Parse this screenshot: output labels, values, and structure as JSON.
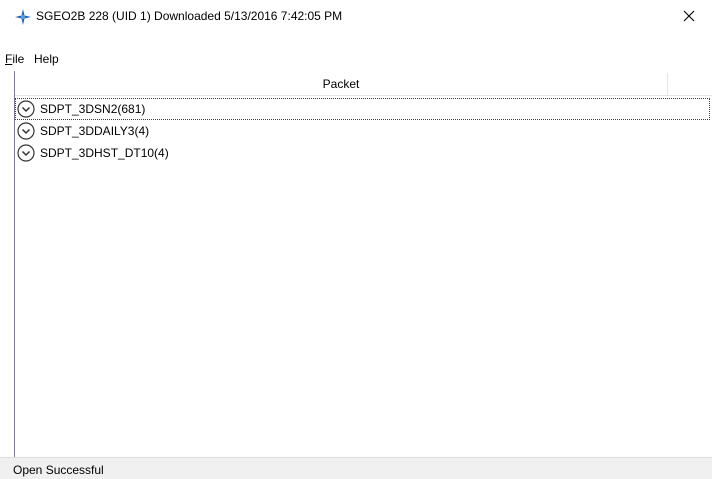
{
  "window": {
    "title": "SGEO2B 228 (UID 1) Downloaded 5/13/2016 7:42:05 PM",
    "accent": "#1e5fb4"
  },
  "menu": {
    "items": [
      {
        "label": "File",
        "mnemonic": "F"
      },
      {
        "label": "Help"
      }
    ]
  },
  "table": {
    "column_header": "Packet"
  },
  "tree": {
    "items": [
      {
        "label": "SDPT_3DSN2(681)",
        "selected": true
      },
      {
        "label": "SDPT_3DDAILY3(4)",
        "selected": false
      },
      {
        "label": "SDPT_3DHST_DT10(4)",
        "selected": false
      }
    ]
  },
  "status": {
    "text": "Open Successful"
  }
}
